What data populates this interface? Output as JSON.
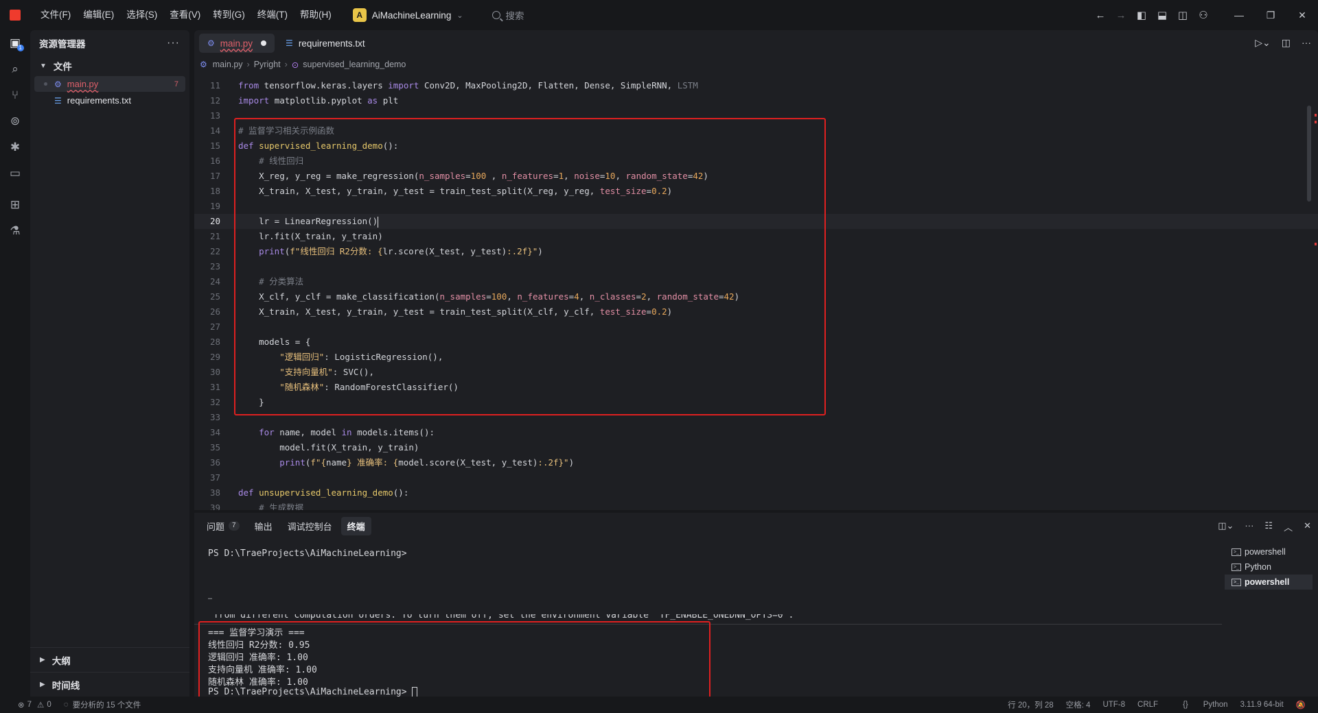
{
  "titlebar": {
    "menu": [
      "文件(F)",
      "编辑(E)",
      "选择(S)",
      "查看(V)",
      "转到(G)",
      "终端(T)",
      "帮助(H)"
    ],
    "workspace_badge": "A",
    "workspace_name": "AiMachineLearning",
    "search_placeholder": "搜索"
  },
  "sidebar": {
    "title": "资源管理器",
    "folder": "文件",
    "files": [
      {
        "name": "main.py",
        "problems": "7"
      },
      {
        "name": "requirements.txt"
      }
    ],
    "outline": "大纲",
    "timeline": "时间线"
  },
  "editor": {
    "tabs": [
      {
        "name": "main.py",
        "modified": true
      },
      {
        "name": "requirements.txt"
      }
    ],
    "breadcrumb": [
      "main.py",
      "Pyright",
      "supervised_learning_demo"
    ],
    "code_lines": [
      {
        "n": "11",
        "tokens": [
          [
            "kw",
            "from "
          ],
          [
            "",
            "tensorflow.keras.layers "
          ],
          [
            "kw",
            "import "
          ],
          [
            "",
            "Conv2D, MaxPooling2D, Flatten, Dense, SimpleRNN, "
          ],
          [
            "cm",
            "LSTM"
          ]
        ]
      },
      {
        "n": "12",
        "tokens": [
          [
            "kw",
            "import "
          ],
          [
            "",
            "matplotlib.pyplot "
          ],
          [
            "kw",
            "as "
          ],
          [
            "",
            "plt"
          ]
        ]
      },
      {
        "n": "13",
        "tokens": []
      },
      {
        "n": "14",
        "tokens": [
          [
            "cm",
            "# 监督学习相关示例函数"
          ]
        ]
      },
      {
        "n": "15",
        "tokens": [
          [
            "kw",
            "def "
          ],
          [
            "fn",
            "supervised_learning_demo"
          ],
          [
            "",
            "():"
          ]
        ]
      },
      {
        "n": "16",
        "tokens": [
          [
            "cm",
            "    # 线性回归"
          ]
        ]
      },
      {
        "n": "17",
        "tokens": [
          [
            "",
            "    X_reg, y_reg = make_regression("
          ],
          [
            "pa",
            "n_samples"
          ],
          [
            "",
            "="
          ],
          [
            "nm",
            "100"
          ],
          [
            "",
            " , "
          ],
          [
            "pa",
            "n_features"
          ],
          [
            "",
            "="
          ],
          [
            "nm",
            "1"
          ],
          [
            "",
            ", "
          ],
          [
            "pa",
            "noise"
          ],
          [
            "",
            "="
          ],
          [
            "nm",
            "10"
          ],
          [
            "",
            ", "
          ],
          [
            "pa",
            "random_state"
          ],
          [
            "",
            "="
          ],
          [
            "nm",
            "42"
          ],
          [
            "",
            ")"
          ]
        ]
      },
      {
        "n": "18",
        "tokens": [
          [
            "",
            "    X_train, X_test, y_train, y_test = train_test_split(X_reg, y_reg, "
          ],
          [
            "pa",
            "test_size"
          ],
          [
            "",
            "="
          ],
          [
            "nm",
            "0.2"
          ],
          [
            "",
            ")"
          ]
        ]
      },
      {
        "n": "19",
        "tokens": []
      },
      {
        "n": "20",
        "tokens": [
          [
            "",
            "    lr = LinearRegression()"
          ]
        ],
        "current": true
      },
      {
        "n": "21",
        "tokens": [
          [
            "",
            "    lr.fit(X_train, y_train)"
          ]
        ]
      },
      {
        "n": "22",
        "tokens": [
          [
            "",
            "    "
          ],
          [
            "kw",
            "print"
          ],
          [
            "",
            "("
          ],
          [
            "st",
            "f\"线性回归 R2分数: {"
          ],
          [
            "",
            "lr.score(X_test, y_test)"
          ],
          [
            "st",
            ":.2f}\""
          ],
          [
            "",
            ")"
          ]
        ]
      },
      {
        "n": "23",
        "tokens": []
      },
      {
        "n": "24",
        "tokens": [
          [
            "cm",
            "    # 分类算法"
          ]
        ]
      },
      {
        "n": "25",
        "tokens": [
          [
            "",
            "    X_clf, y_clf = make_classification("
          ],
          [
            "pa",
            "n_samples"
          ],
          [
            "",
            "="
          ],
          [
            "nm",
            "100"
          ],
          [
            "",
            ", "
          ],
          [
            "pa",
            "n_features"
          ],
          [
            "",
            "="
          ],
          [
            "nm",
            "4"
          ],
          [
            "",
            ", "
          ],
          [
            "pa",
            "n_classes"
          ],
          [
            "",
            "="
          ],
          [
            "nm",
            "2"
          ],
          [
            "",
            ", "
          ],
          [
            "pa",
            "random_state"
          ],
          [
            "",
            "="
          ],
          [
            "nm",
            "42"
          ],
          [
            "",
            ")"
          ]
        ]
      },
      {
        "n": "26",
        "tokens": [
          [
            "",
            "    X_train, X_test, y_train, y_test = train_test_split(X_clf, y_clf, "
          ],
          [
            "pa",
            "test_size"
          ],
          [
            "",
            "="
          ],
          [
            "nm",
            "0.2"
          ],
          [
            "",
            ")"
          ]
        ]
      },
      {
        "n": "27",
        "tokens": []
      },
      {
        "n": "28",
        "tokens": [
          [
            "",
            "    models = {"
          ]
        ]
      },
      {
        "n": "29",
        "tokens": [
          [
            "st",
            "        \"逻辑回归\""
          ],
          [
            "",
            ": LogisticRegression(),"
          ]
        ]
      },
      {
        "n": "30",
        "tokens": [
          [
            "st",
            "        \"支持向量机\""
          ],
          [
            "",
            ": SVC(),"
          ]
        ]
      },
      {
        "n": "31",
        "tokens": [
          [
            "st",
            "        \"随机森林\""
          ],
          [
            "",
            ": RandomForestClassifier()"
          ]
        ]
      },
      {
        "n": "32",
        "tokens": [
          [
            "",
            "    }"
          ]
        ]
      },
      {
        "n": "33",
        "tokens": []
      },
      {
        "n": "34",
        "tokens": [
          [
            "kw",
            "    for "
          ],
          [
            "",
            "name, model "
          ],
          [
            "kw",
            "in "
          ],
          [
            "",
            "models.items():"
          ]
        ]
      },
      {
        "n": "35",
        "tokens": [
          [
            "",
            "        model.fit(X_train, y_train)"
          ]
        ]
      },
      {
        "n": "36",
        "tokens": [
          [
            "",
            "        "
          ],
          [
            "kw",
            "print"
          ],
          [
            "",
            "("
          ],
          [
            "st",
            "f\"{"
          ],
          [
            "",
            "name"
          ],
          [
            "st",
            "} 准确率: {"
          ],
          [
            "",
            "model.score(X_test, y_test)"
          ],
          [
            "st",
            ":.2f}\""
          ],
          [
            "",
            ")"
          ]
        ]
      },
      {
        "n": "37",
        "tokens": []
      },
      {
        "n": "38",
        "tokens": [
          [
            "kw",
            "def "
          ],
          [
            "fn",
            "unsupervised_learning_demo"
          ],
          [
            "",
            "():"
          ]
        ]
      },
      {
        "n": "39",
        "tokens": [
          [
            "cm",
            "    # 生成数据"
          ]
        ]
      }
    ]
  },
  "panel": {
    "tabs": [
      {
        "label": "问题",
        "count": "7"
      },
      {
        "label": "输出"
      },
      {
        "label": "调试控制台"
      },
      {
        "label": "终端",
        "active": true
      }
    ],
    "terminal_lines": [
      "PS D:\\TraeProjects\\AiMachineLearning>",
      "…",
      "from different computation orders. To turn them off, set the environment variable `TF_ENABLE_ONEDNN_OPTS=0`.",
      "=== 监督学习演示 ===",
      "线性回归 R2分数: 0.95",
      "逻辑回归 准确率: 1.00",
      "支持向量机 准确率: 1.00",
      "随机森林 准确率: 1.00",
      "PS D:\\TraeProjects\\AiMachineLearning> "
    ],
    "terminals": [
      "powershell",
      "Python",
      "powershell"
    ]
  },
  "statusbar": {
    "errors": "7",
    "warnings": "0",
    "analysis": "要分析的 15 个文件",
    "position": "行 20，列 28",
    "spaces": "空格: 4",
    "encoding": "UTF-8",
    "eol": "CRLF",
    "language": "Python",
    "interpreter": "3.11.9 64-bit"
  },
  "colors": {
    "highlight_box": "#e02020",
    "accent": "#3d82f6"
  }
}
